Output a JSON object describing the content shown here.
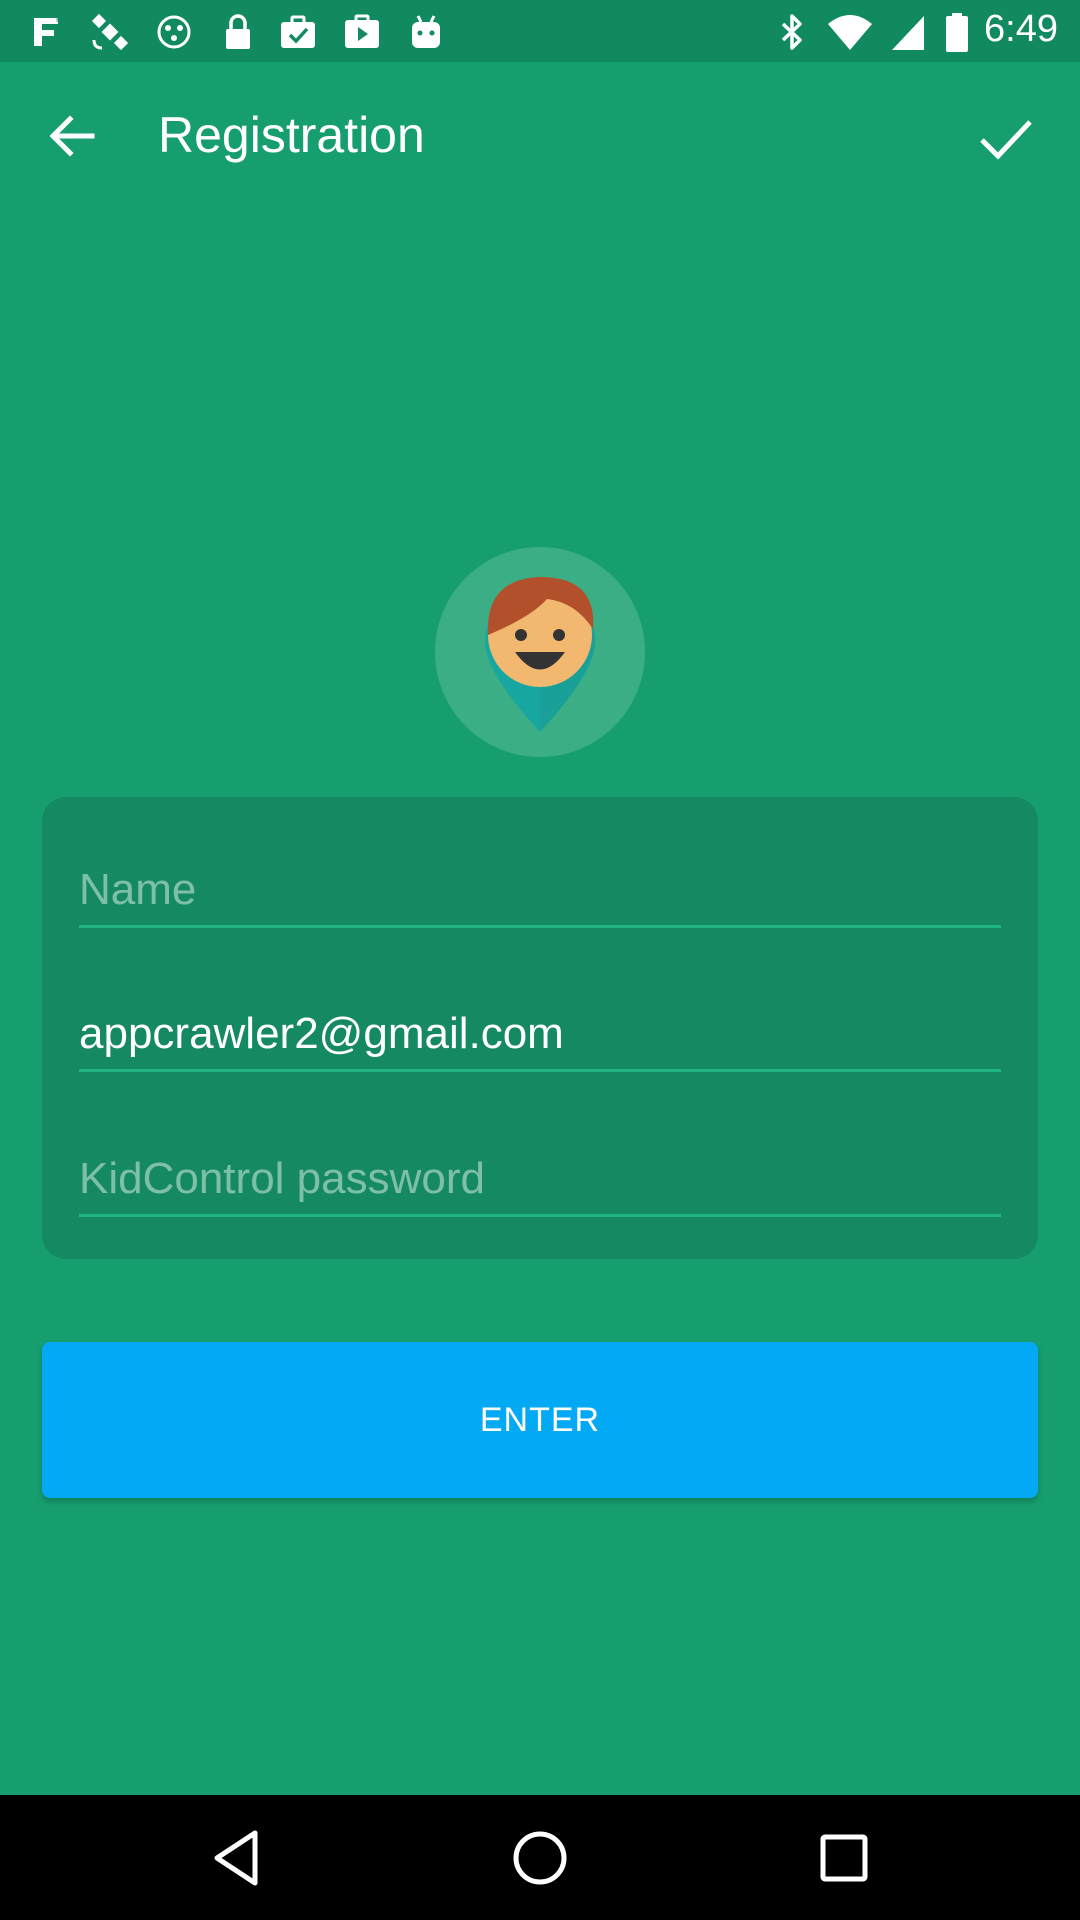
{
  "status_bar": {
    "time": "6:49",
    "icons": [
      "fake-gps-icon",
      "satellite-icon",
      "no-sim-icon",
      "lock-icon",
      "briefcase-check-icon",
      "play-store-icon",
      "android-icon",
      "bluetooth-icon",
      "wifi-icon",
      "signal-icon",
      "battery-icon"
    ]
  },
  "app_bar": {
    "title": "Registration",
    "back_icon": "arrow-back-icon",
    "confirm_icon": "check-icon"
  },
  "avatar": {
    "icon": "child-location-pin-icon"
  },
  "form": {
    "name": {
      "value": "",
      "placeholder": "Name"
    },
    "email": {
      "value": "appcrawler2@gmail.com",
      "placeholder": ""
    },
    "password": {
      "value": "",
      "placeholder": "KidControl password"
    }
  },
  "enter_button": {
    "label": "ENTER"
  },
  "colors": {
    "background": "#169e6f",
    "status_bar": "#128a5f",
    "card": "#158a62",
    "field_line": "#1eb583",
    "button": "#03a9f4"
  },
  "nav_bar": {
    "icons": [
      "back-triangle-icon",
      "home-circle-icon",
      "recents-square-icon"
    ]
  }
}
